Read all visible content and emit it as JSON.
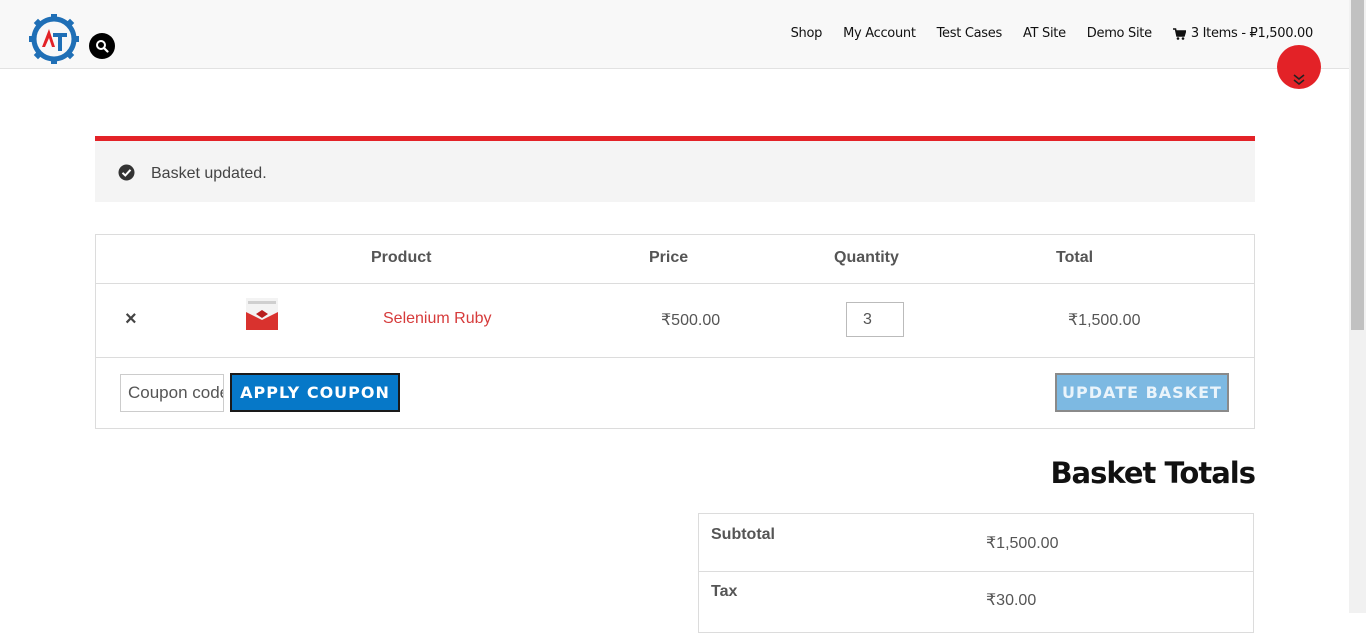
{
  "header": {
    "logo_text": "AT",
    "nav": [
      {
        "label": "Shop"
      },
      {
        "label": "My Account"
      },
      {
        "label": "Test Cases"
      },
      {
        "label": "AT Site"
      },
      {
        "label": "Demo Site"
      }
    ],
    "cart_label": "3 Items - ₽1,500.00"
  },
  "notice": {
    "message": "Basket updated."
  },
  "cart": {
    "columns": [
      "Product",
      "Price",
      "Quantity",
      "Total"
    ],
    "item": {
      "remove": "×",
      "name": "Selenium Ruby",
      "price": "₹500.00",
      "quantity": "3",
      "total": "₹1,500.00"
    },
    "coupon_placeholder": "Coupon code",
    "apply_label": "APPLY COUPON",
    "update_label": "UPDATE BASKET"
  },
  "totals": {
    "title": "Basket Totals",
    "rows": [
      {
        "label": "Subtotal",
        "value": "₹1,500.00"
      },
      {
        "label": "Tax",
        "value": "₹30.00"
      }
    ]
  },
  "colors": {
    "accent_red": "#e32227",
    "button_blue": "#0678c8",
    "button_disabled": "#7db9e2",
    "link_red": "#d63b3b"
  }
}
